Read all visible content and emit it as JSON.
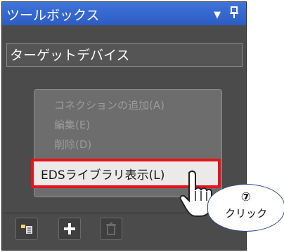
{
  "toolbox": {
    "title": "ツールボックス",
    "dropdown_glyph": "▼",
    "pin_glyph": "📌",
    "target_device_label": "ターゲットデバイス"
  },
  "context_menu": {
    "items": [
      {
        "label": "コネクションの追加(A)",
        "enabled": false
      },
      {
        "label": "編集(E)",
        "enabled": false
      },
      {
        "label": "削除(D)",
        "enabled": false
      },
      {
        "label": "EDSライブラリ表示(L)",
        "enabled": true,
        "highlighted": true
      }
    ]
  },
  "toolbar": {
    "buttons": [
      {
        "icon": "device-list-icon"
      },
      {
        "icon": "add-icon"
      },
      {
        "icon": "delete-icon"
      }
    ]
  },
  "callout": {
    "step": "⑦",
    "text": "クリック"
  }
}
